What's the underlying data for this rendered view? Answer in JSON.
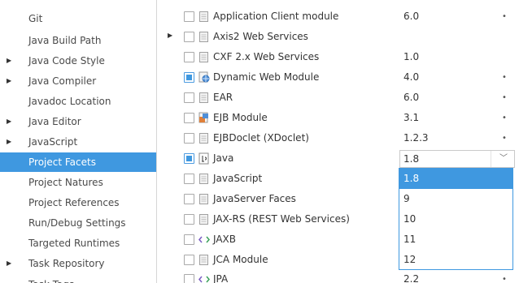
{
  "nav": {
    "items": [
      {
        "label": "Git",
        "expandable": false,
        "selected": false
      },
      {
        "label": "Java Build Path",
        "expandable": false,
        "selected": false
      },
      {
        "label": "Java Code Style",
        "expandable": true,
        "selected": false
      },
      {
        "label": "Java Compiler",
        "expandable": true,
        "selected": false
      },
      {
        "label": "Javadoc Location",
        "expandable": false,
        "selected": false
      },
      {
        "label": "Java Editor",
        "expandable": true,
        "selected": false
      },
      {
        "label": "JavaScript",
        "expandable": true,
        "selected": false
      },
      {
        "label": "Project Facets",
        "expandable": false,
        "selected": true
      },
      {
        "label": "Project Natures",
        "expandable": false,
        "selected": false
      },
      {
        "label": "Project References",
        "expandable": false,
        "selected": false
      },
      {
        "label": "Run/Debug Settings",
        "expandable": false,
        "selected": false
      },
      {
        "label": "Targeted Runtimes",
        "expandable": false,
        "selected": false
      },
      {
        "label": "Task Repository",
        "expandable": true,
        "selected": false
      },
      {
        "label": "Task Tags",
        "expandable": false,
        "selected": false
      }
    ]
  },
  "facets": [
    {
      "name": "Application Client module",
      "version": "6.0",
      "checked": false,
      "icon": "document-icon",
      "has_menu": true,
      "expandable": false
    },
    {
      "name": "Axis2 Web Services",
      "version": "",
      "checked": false,
      "icon": "document-icon",
      "has_menu": false,
      "expandable": true
    },
    {
      "name": "CXF 2.x Web Services",
      "version": "1.0",
      "checked": false,
      "icon": "document-icon",
      "has_menu": false,
      "expandable": false
    },
    {
      "name": "Dynamic Web Module",
      "version": "4.0",
      "checked": true,
      "icon": "web-module-icon",
      "has_menu": true,
      "expandable": false
    },
    {
      "name": "EAR",
      "version": "6.0",
      "checked": false,
      "icon": "document-icon",
      "has_menu": true,
      "expandable": false
    },
    {
      "name": "EJB Module",
      "version": "3.1",
      "checked": false,
      "icon": "ejb-icon",
      "has_menu": true,
      "expandable": false
    },
    {
      "name": "EJBDoclet (XDoclet)",
      "version": "1.2.3",
      "checked": false,
      "icon": "document-icon",
      "has_menu": true,
      "expandable": false
    },
    {
      "name": "Java",
      "version": "1.8",
      "checked": true,
      "icon": "java-icon",
      "has_menu": true,
      "expandable": false,
      "selected": true
    },
    {
      "name": "JavaScript",
      "version": "",
      "checked": false,
      "icon": "document-icon",
      "has_menu": false,
      "expandable": false
    },
    {
      "name": "JavaServer Faces",
      "version": "",
      "checked": false,
      "icon": "document-icon",
      "has_menu": false,
      "expandable": false
    },
    {
      "name": "JAX-RS (REST Web Services)",
      "version": "",
      "checked": false,
      "icon": "document-icon",
      "has_menu": false,
      "expandable": false
    },
    {
      "name": "JAXB",
      "version": "",
      "checked": false,
      "icon": "jaxb-icon",
      "has_menu": false,
      "expandable": false
    },
    {
      "name": "JCA Module",
      "version": "",
      "checked": false,
      "icon": "document-icon",
      "has_menu": false,
      "expandable": false
    },
    {
      "name": "JPA",
      "version": "2.2",
      "checked": false,
      "icon": "jpa-icon",
      "has_menu": true,
      "expandable": false
    }
  ],
  "version_dropdown": {
    "selected": "1.8",
    "options": [
      "1.8",
      "9",
      "10",
      "11",
      "12"
    ]
  },
  "symbols": {
    "expand_arrow": "▶",
    "chevron": "﹀",
    "menu_dot": "•"
  },
  "colors": {
    "selection": "#3f98e0",
    "divider": "#d6d6d6"
  }
}
